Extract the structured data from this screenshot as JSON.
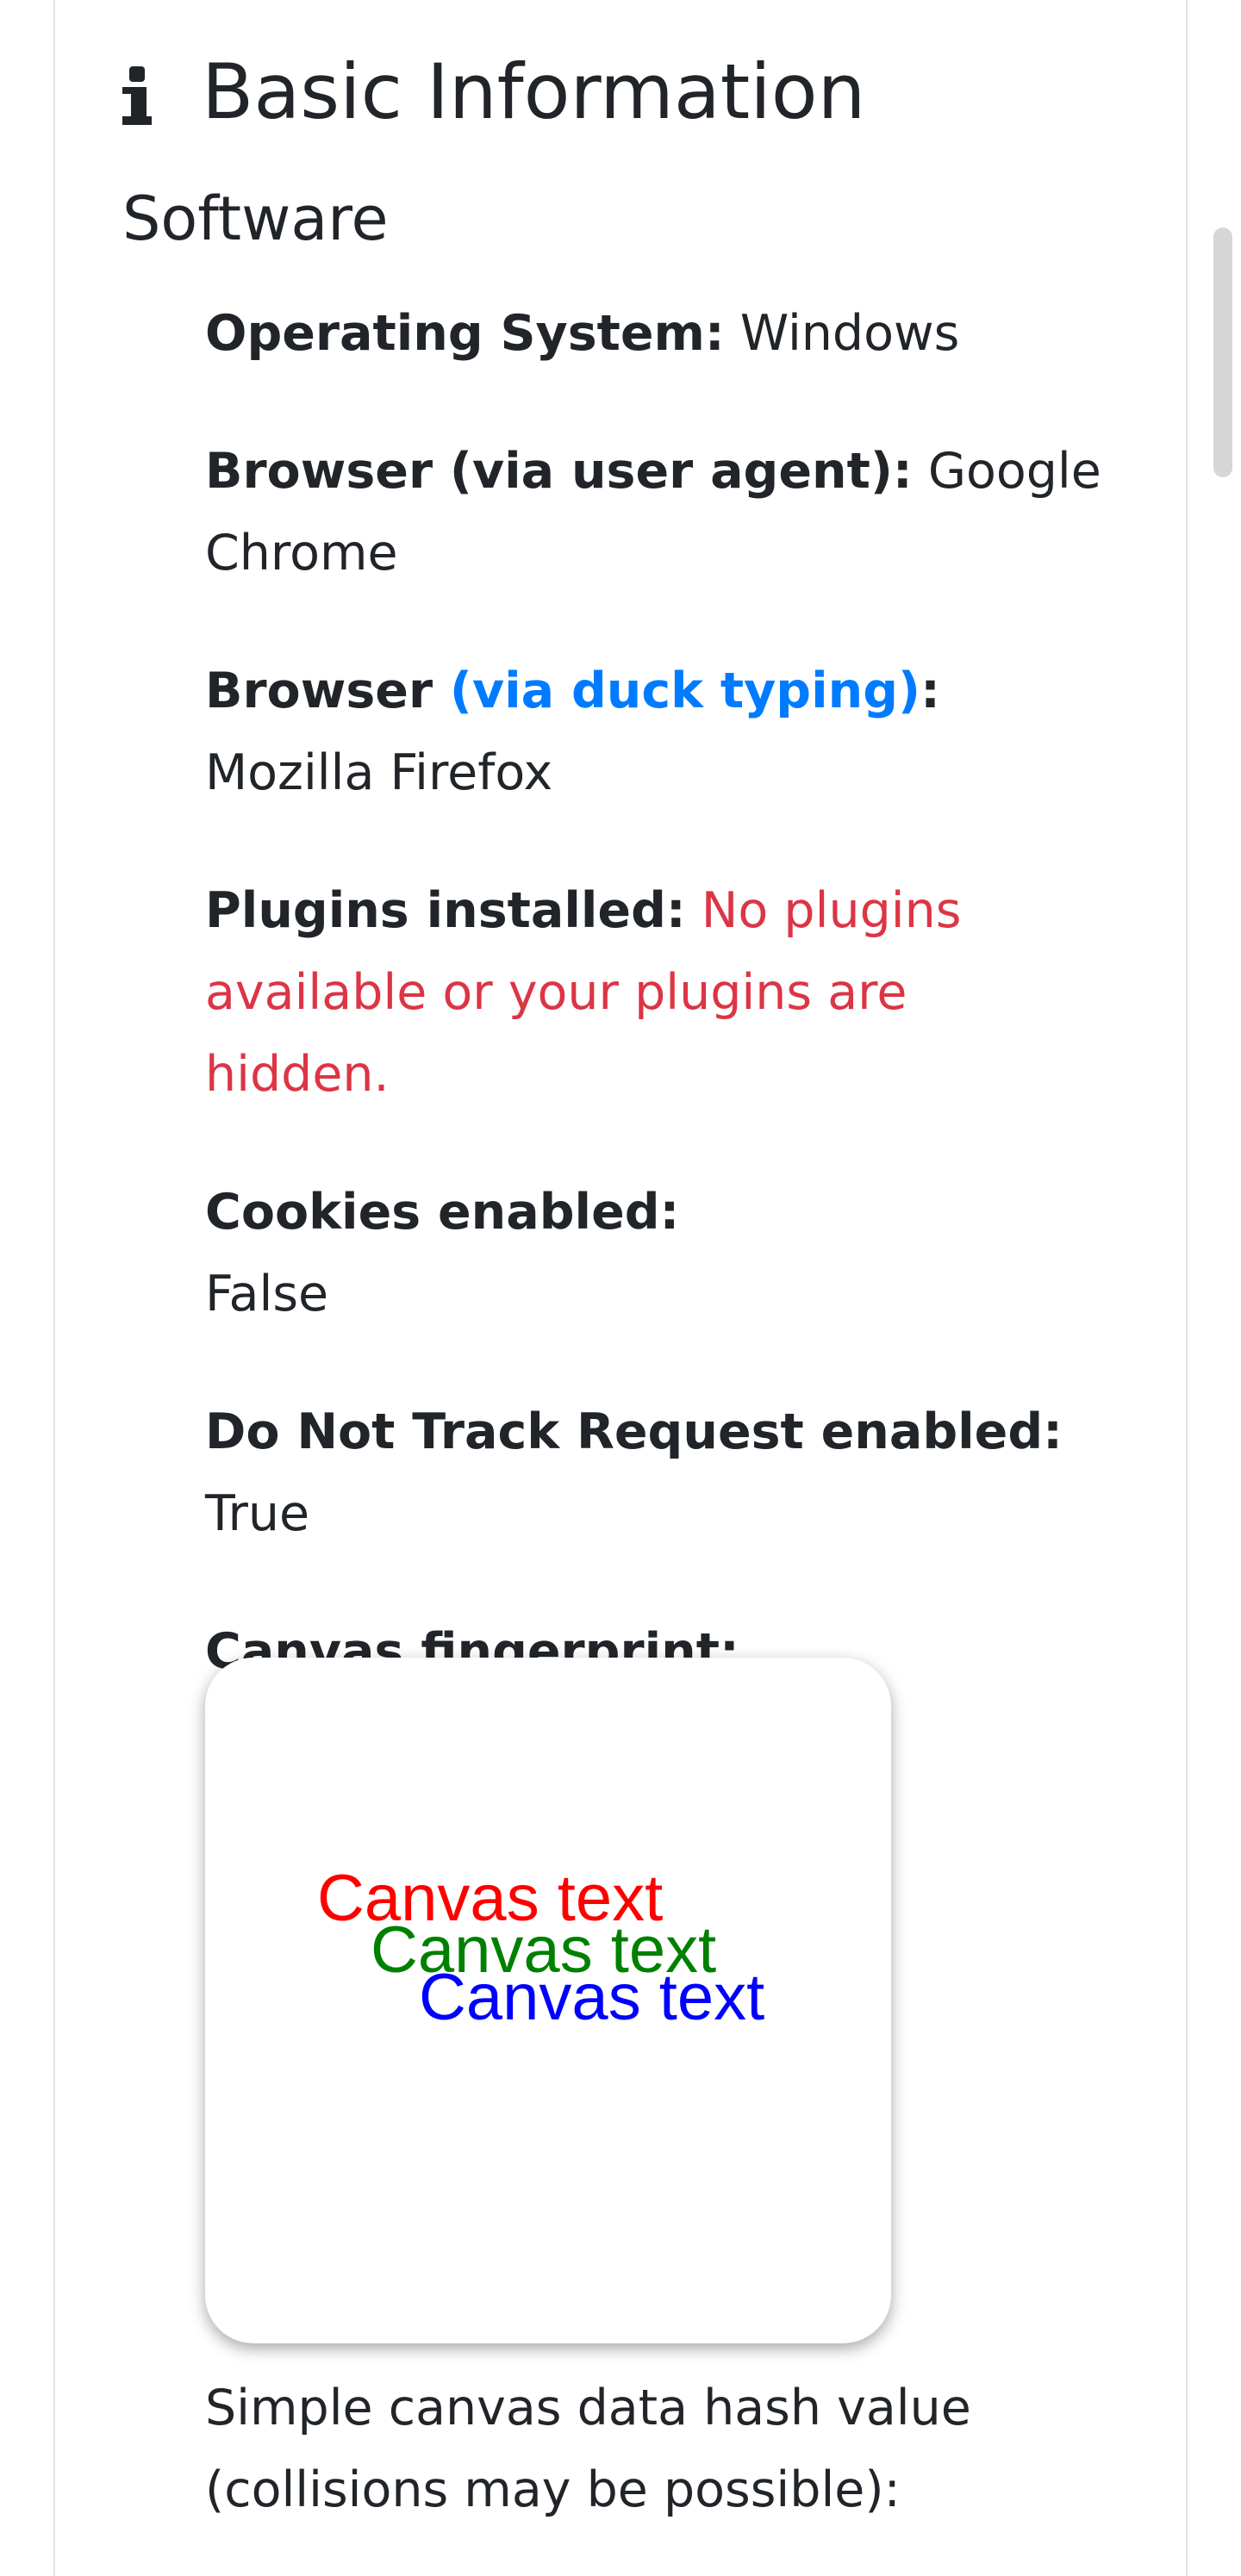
{
  "header": {
    "title": "Basic Information",
    "icon": "info-icon"
  },
  "section": {
    "title": "Software"
  },
  "items": {
    "os": {
      "label": "Operating System:",
      "value": "Windows"
    },
    "browser_ua": {
      "label": "Browser (via user agent):",
      "value": "Google Chrome"
    },
    "browser_duck": {
      "label_prefix": "Browser ",
      "link": "(via duck typing)",
      "colon": ":",
      "value": "Mozilla Firefox"
    },
    "plugins": {
      "label": "Plugins installed:",
      "value": "No plugins available or your plugins are hidden."
    },
    "cookies": {
      "label": "Cookies enabled:",
      "value": "False"
    },
    "dnt": {
      "label": "Do Not Track Request enabled:",
      "value": "True"
    },
    "canvas": {
      "label": "Canvas fingerprint:"
    }
  },
  "canvas_image": {
    "lines": [
      "Canvas text",
      "Canvas text",
      "Canvas text"
    ],
    "colors": [
      "#ff0000",
      "#008000",
      "#0000ff"
    ]
  },
  "hash": {
    "label": "Simple canvas data hash value (collisions may be possible):"
  },
  "colors": {
    "link": "#007bff",
    "warning": "#dc3545",
    "text": "#212529"
  }
}
